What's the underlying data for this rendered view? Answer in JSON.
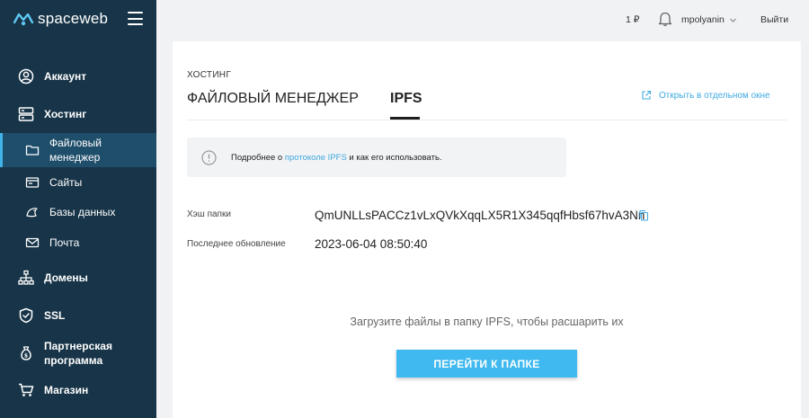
{
  "brand": {
    "name": "spaceweb"
  },
  "sidebar": {
    "items": [
      {
        "label": "Аккаунт",
        "icon": "user-circle-icon"
      },
      {
        "label": "Хостинг",
        "icon": "server-icon"
      },
      {
        "label": "Файловый менеджер",
        "line1": "Файловый",
        "line2": "менеджер",
        "icon": "folder-icon",
        "active": true
      },
      {
        "label": "Сайты",
        "icon": "website-icon"
      },
      {
        "label": "Базы данных",
        "icon": "database-icon"
      },
      {
        "label": "Почта",
        "icon": "mail-icon"
      },
      {
        "label": "Домены",
        "icon": "sitemap-icon"
      },
      {
        "label": "SSL",
        "icon": "shield-icon"
      },
      {
        "label": "Партнерская программа",
        "line1": "Партнерская",
        "line2": "программа",
        "icon": "money-bag-icon"
      },
      {
        "label": "Магазин",
        "icon": "cart-icon"
      }
    ]
  },
  "topbar": {
    "balance": "1 ₽",
    "username": "mpolyanin",
    "logout": "Выйти"
  },
  "page": {
    "breadcrumb": "ХОСТИНГ",
    "tabs": [
      {
        "label": "ФАЙЛОВЫЙ МЕНЕДЖЕР"
      },
      {
        "label": "IPFS",
        "active": true
      }
    ],
    "open_window": "Открыть в отдельном окне",
    "info": {
      "prefix": "Подробнее о ",
      "link": "протоколе IPFS",
      "suffix": " и как его использовать."
    },
    "hash_label": "Хэш папки",
    "hash_value": "QmUNLLsPACCz1vLxQVkXqqLX5R1X345qqfHbsf67hvA3Nn",
    "updated_label": "Последнее обновление",
    "updated_value": "2023-06-04 08:50:40",
    "upload_text": "Загрузите файлы в папку IPFS, чтобы расшарить их",
    "button": "ПЕРЕЙТИ К ПАПКЕ"
  },
  "colors": {
    "sidebar_bg": "#173448",
    "active_bg": "#1f4e6b",
    "accent": "#3fb9ef",
    "link": "#3fa9e0"
  }
}
